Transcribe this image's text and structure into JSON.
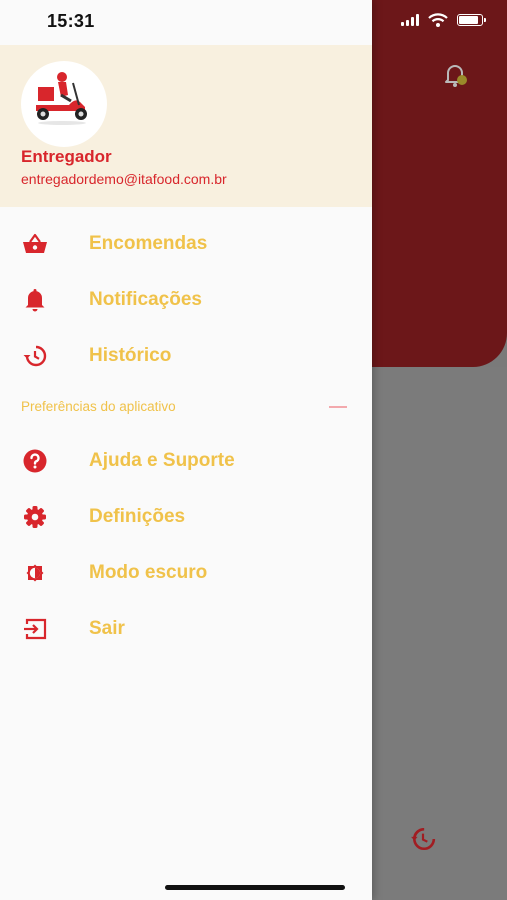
{
  "status_bar": {
    "time": "15:31"
  },
  "drawer": {
    "user": {
      "name": "Entregador",
      "email": "entregadordemo@itafood.com.br",
      "avatar_icon": "delivery-scooter-icon"
    },
    "menu_items": [
      {
        "label": "Encomendas",
        "icon": "basket-icon"
      },
      {
        "label": "Notificações",
        "icon": "bell-icon"
      },
      {
        "label": "Histórico",
        "icon": "history-icon"
      }
    ],
    "preferences_section": {
      "label": "Preferências do aplicativo",
      "items": [
        {
          "label": "Ajuda e Suporte",
          "icon": "help-icon"
        },
        {
          "label": "Definições",
          "icon": "gear-icon"
        },
        {
          "label": "Modo escuro",
          "icon": "dark-mode-icon"
        },
        {
          "label": "Sair",
          "icon": "logout-icon"
        }
      ]
    }
  },
  "colors": {
    "accent_red": "#d8262c",
    "label_yellow": "#f0c24a",
    "header_cream": "#f8f0df",
    "background_dark_red": "#6c1719"
  }
}
